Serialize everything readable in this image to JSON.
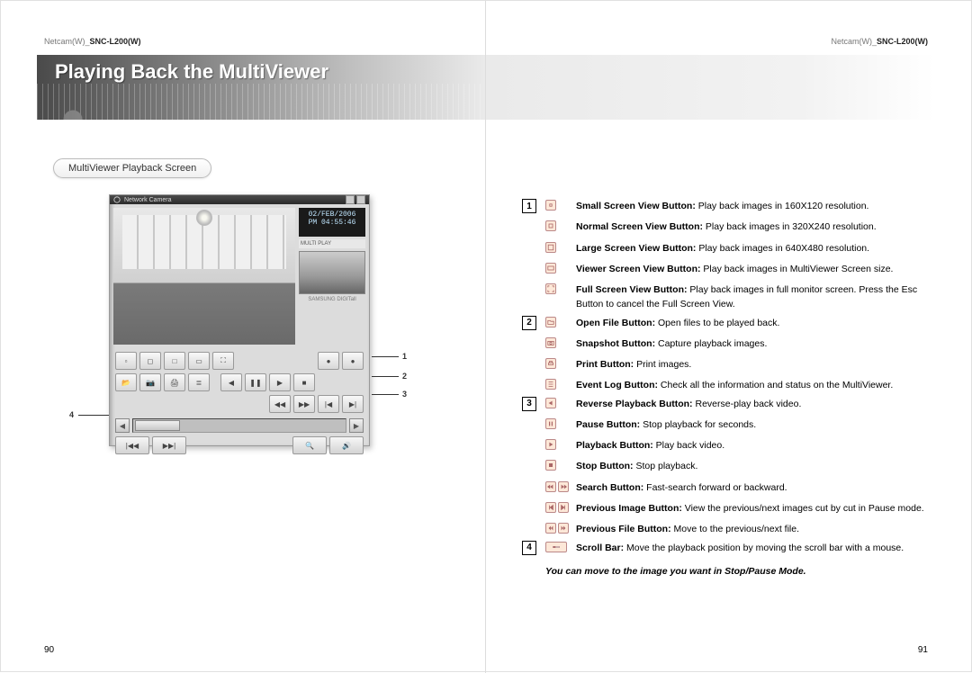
{
  "product": {
    "brand": "Netcam(W)_",
    "model": "SNC-L200(W)"
  },
  "page_left": {
    "title": "Playing Back the MultiViewer",
    "section_label": "MultiViewer Playback Screen",
    "page_number": "90",
    "screenshot": {
      "window_title": "Network Camera",
      "date_line": "02/FEB/2006",
      "time_line": "PM 04:55:46",
      "panel_label": "MULTI PLAY",
      "callouts": {
        "c1": "1",
        "c2": "2",
        "c3": "3",
        "c4": "4"
      }
    }
  },
  "page_right": {
    "page_number": "91",
    "groups": [
      {
        "num": "1",
        "items": [
          {
            "icon": "small-screen",
            "bold": "Small Screen View Button:",
            "text": " Play back images in 160X120 resolution."
          },
          {
            "icon": "normal-screen",
            "bold": "Normal Screen View Button:",
            "text": " Play back images in 320X240 resolution."
          },
          {
            "icon": "large-screen",
            "bold": "Large Screen View Button:",
            "text": " Play back images in 640X480 resolution."
          },
          {
            "icon": "viewer-screen",
            "bold": "Viewer Screen View Button:",
            "text": " Play back images in MultiViewer Screen size."
          },
          {
            "icon": "full-screen",
            "bold": "Full Screen View Button:",
            "text": " Play back images in full monitor screen. Press the Esc Button to cancel the Full Screen View."
          }
        ]
      },
      {
        "num": "2",
        "items": [
          {
            "icon": "open-file",
            "bold": "Open File Button:",
            "text": " Open files to be played back."
          },
          {
            "icon": "snapshot",
            "bold": "Snapshot Button:",
            "text": " Capture playback images."
          },
          {
            "icon": "print",
            "bold": "Print Button:",
            "text": " Print images."
          },
          {
            "icon": "event-log",
            "bold": "Event Log Button:",
            "text": " Check all the information and status on the MultiViewer."
          }
        ]
      },
      {
        "num": "3",
        "items": [
          {
            "icon": "reverse",
            "bold": "Reverse Playback Button:",
            "text": " Reverse-play back video."
          },
          {
            "icon": "pause",
            "bold": "Pause Button:",
            "text": " Stop playback for seconds."
          },
          {
            "icon": "play",
            "bold": "Playback Button:",
            "text": " Play back video."
          },
          {
            "icon": "stop",
            "bold": "Stop Button:",
            "text": " Stop playback."
          },
          {
            "icon": "search-pair",
            "bold": "Search Button:",
            "text": " Fast-search forward or backward."
          },
          {
            "icon": "prev-image-pair",
            "bold": "Previous Image Button:",
            "text": " View the previous/next images cut by cut in Pause mode."
          },
          {
            "icon": "prev-file-pair",
            "bold": "Previous File Button:",
            "text": " Move to the previous/next file."
          }
        ]
      },
      {
        "num": "4",
        "items": [
          {
            "icon": "scrollbar",
            "bold": "Scroll Bar:",
            "text": " Move the playback position by moving the scroll bar with a mouse."
          }
        ]
      }
    ],
    "footnote": "You can move to the image you want in Stop/Pause Mode."
  }
}
